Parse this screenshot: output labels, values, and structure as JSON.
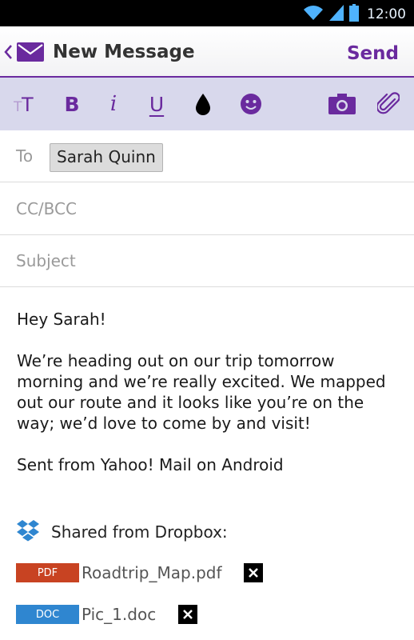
{
  "status_bar": {
    "time": "12:00"
  },
  "app_bar": {
    "title": "New Message",
    "send_label": "Send"
  },
  "toolbar": {
    "bold_label": "B",
    "italic_label": "i",
    "underline_label": "U"
  },
  "compose": {
    "to_label": "To",
    "to_recipient": "Sarah Quinn",
    "cc_placeholder": "CC/BCC",
    "subject_placeholder": "Subject"
  },
  "body": {
    "greeting": "Hey Sarah!",
    "message": "We’re heading out on our trip tomorrow morning and we’re really excited. We mapped out our route and it looks like you’re on the way; we’d love to come by and visit!",
    "signature": "Sent from Yahoo! Mail on Android"
  },
  "dropbox": {
    "heading": "Shared from Dropbox:",
    "attachments": [
      {
        "type_label": "PDF",
        "name": "Roadtrip_Map.pdf"
      },
      {
        "type_label": "DOC",
        "name": "Pic_1.doc"
      }
    ]
  },
  "colors": {
    "accent": "#6a2a9e",
    "toolbar_bg": "#d8d8ec",
    "pdf_badge": "#c84322",
    "doc_badge": "#2f86d0",
    "dropbox_blue": "#2f86d0"
  }
}
